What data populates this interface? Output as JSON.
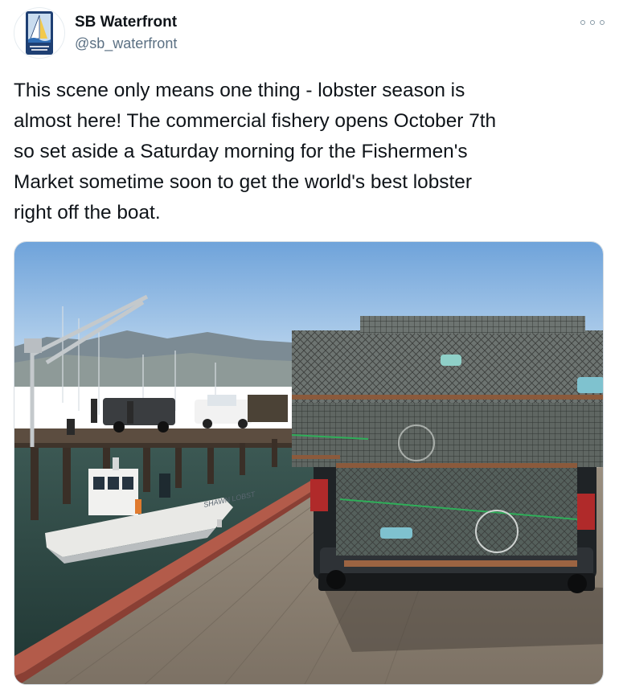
{
  "account": {
    "display_name": "SB Waterfront",
    "handle": "@sb_waterfront",
    "avatar_logo_text": "SANTA BARBARA WATERFRONT"
  },
  "actions": {
    "more_icon": "more-horizontal-icon"
  },
  "tweet": {
    "text": "This scene only means one thing - lobster season is\nalmost here! The commercial fishery opens October 7th\nso set aside a Saturday morning for the Fishermen's\nMarket sometime soon to get the world's best lobster\nright off the boat."
  },
  "media": {
    "boat_name": "SHAWN LOBST"
  }
}
